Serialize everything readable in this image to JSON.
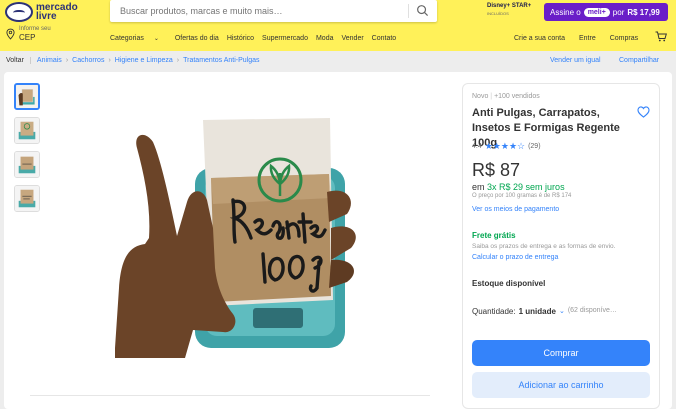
{
  "header": {
    "logo_line1": "mercado",
    "logo_line2": "livre",
    "search_placeholder": "Buscar produtos, marcas e muito mais…",
    "disney_title": "Disney+ STAR+",
    "disney_sub": "INCLUÍDOS",
    "promo_label": "Assine o",
    "promo_pill": "meli+",
    "promo_per": "por",
    "promo_price": "R$ 17,99",
    "cep_label": "Informe seu",
    "cep_value": "CEP",
    "nav": [
      "Categorias",
      "Ofertas do dia",
      "Histórico",
      "Supermercado",
      "Moda",
      "Vender",
      "Contato"
    ],
    "user_nav": [
      "Crie a sua conta",
      "Entre",
      "Compras"
    ]
  },
  "breadcrumb": {
    "back": "Voltar",
    "items": [
      "Animais",
      "Cachorros",
      "Higiene e Limpeza",
      "Tratamentos Anti-Pulgas"
    ],
    "sell_similar": "Vender um igual",
    "share": "Compartilhar"
  },
  "product": {
    "condition": "Novo",
    "sold": "+100 vendidos",
    "title": "Anti Pulgas, Carrapatos, Insetos E Formigas Regente 100g",
    "rating_value": "4.4",
    "rating_stars": 4.4,
    "reviews": "(29)",
    "price": "R$ 87",
    "installments_prefix": "em",
    "installments": "3x R$ 29 sem juros",
    "unit_price": "O preço por 100 gramas é de R$ 174",
    "payment_link": "Ver os meios de pagamento",
    "shipping": "Frete grátis",
    "shipping_desc": "Saiba os prazos de entrega e as formas de envio.",
    "shipping_link": "Calcular o prazo de entrega",
    "stock": "Estoque disponível",
    "qty_label": "Quantidade:",
    "qty_value": "1 unidade",
    "qty_avail": "(62 disponíve…",
    "buy_label": "Comprar",
    "cart_label": "Adicionar ao carrinho"
  },
  "colors": {
    "header_bg": "#fff159",
    "accent": "#3483fa",
    "green": "#00a650",
    "meli_purple": "#6a1ec8"
  }
}
